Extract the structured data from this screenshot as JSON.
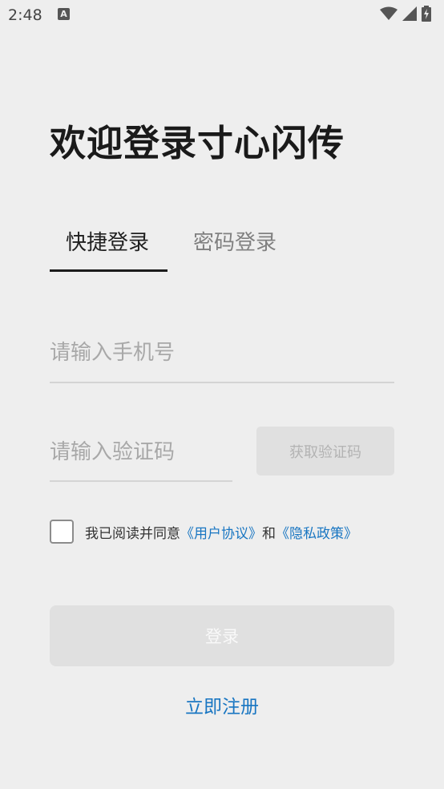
{
  "status_bar": {
    "time": "2:48",
    "notification_icon": "text-a-icon",
    "icons": [
      "wifi-icon",
      "cellular-signal-icon",
      "battery-charging-icon"
    ]
  },
  "title": "欢迎登录寸心闪传",
  "tabs": [
    {
      "label": "快捷登录",
      "active": true
    },
    {
      "label": "密码登录",
      "active": false
    }
  ],
  "phone_field": {
    "placeholder": "请输入手机号",
    "value": ""
  },
  "code_field": {
    "placeholder": "请输入验证码",
    "value": ""
  },
  "get_code_button": "获取验证码",
  "agreement": {
    "checked": false,
    "prefix": "我已阅读并同意",
    "user_agreement": "《用户协议》",
    "and": "和",
    "privacy_policy": "《隐私政策》"
  },
  "login_button": "登录",
  "register_link": "立即注册",
  "colors": {
    "background": "#eeeeee",
    "link": "#1976c2",
    "button_disabled": "#e0e0e0",
    "tab_indicator": "#1c1c1c"
  }
}
